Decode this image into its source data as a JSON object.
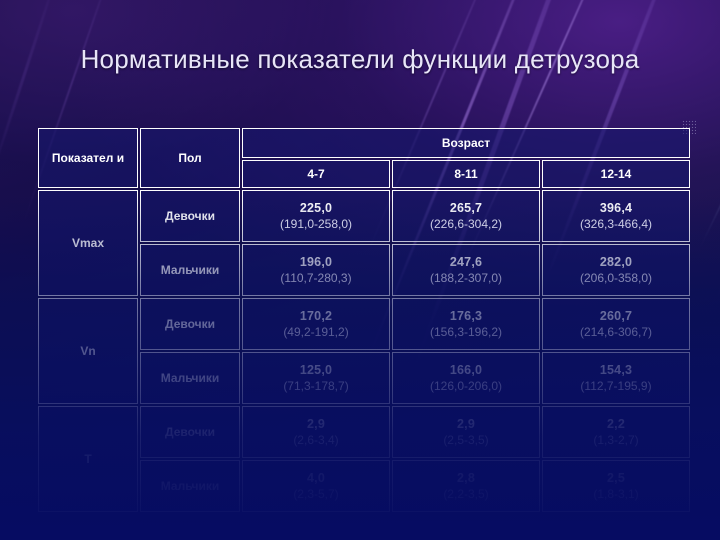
{
  "slide": {
    "title": "Нормативные показатели функции детрузора",
    "accent_color": "#ffffff",
    "background_color": "#0c1148",
    "title_color": "#e8e6f8"
  },
  "table": {
    "headers": {
      "indicator": "Показател и",
      "sex": "Пол",
      "age_group": "Возраст",
      "ages": [
        "4-7",
        "8-11",
        "12-14"
      ]
    },
    "rows": [
      {
        "indicator": "Vmax",
        "sex": "Девочки",
        "values": [
          {
            "mean": "225,0",
            "range": "(191,0-258,0)"
          },
          {
            "mean": "265,7",
            "range": "(226,6-304,2)"
          },
          {
            "mean": "396,4",
            "range": "(326,3-466,4)"
          }
        ]
      },
      {
        "indicator": "",
        "sex": "Мальчики",
        "values": [
          {
            "mean": "196,0",
            "range": "(110,7-280,3)"
          },
          {
            "mean": "247,6",
            "range": "(188,2-307,0)"
          },
          {
            "mean": "282,0",
            "range": "(206,0-358,0)"
          }
        ]
      },
      {
        "indicator": "Vn",
        "sex": "Девочки",
        "values": [
          {
            "mean": "170,2",
            "range": "(49,2-191,2)"
          },
          {
            "mean": "176,3",
            "range": "(156,3-196,2)"
          },
          {
            "mean": "260,7",
            "range": "(214,6-306,7)"
          }
        ]
      },
      {
        "indicator": "",
        "sex": "Мальчики",
        "values": [
          {
            "mean": "125,0",
            "range": "(71,3-178,7)"
          },
          {
            "mean": "166,0",
            "range": "(126,0-206,0)"
          },
          {
            "mean": "154,3",
            "range": "(112,7-195,9)"
          }
        ]
      },
      {
        "indicator": "T",
        "sex": "Девочки",
        "values": [
          {
            "mean": "2,9",
            "range": "(2,6-3,4)"
          },
          {
            "mean": "2,9",
            "range": "(2,5-3,5)"
          },
          {
            "mean": "2,2",
            "range": "(1,3-2,7)"
          }
        ]
      },
      {
        "indicator": "",
        "sex": "Мальчики",
        "values": [
          {
            "mean": "4,0",
            "range": "(2,3-5,7)"
          },
          {
            "mean": "2,8",
            "range": "(2,2-3,5)"
          },
          {
            "mean": "2,5",
            "range": "(1,8-3,1)"
          }
        ]
      }
    ]
  }
}
